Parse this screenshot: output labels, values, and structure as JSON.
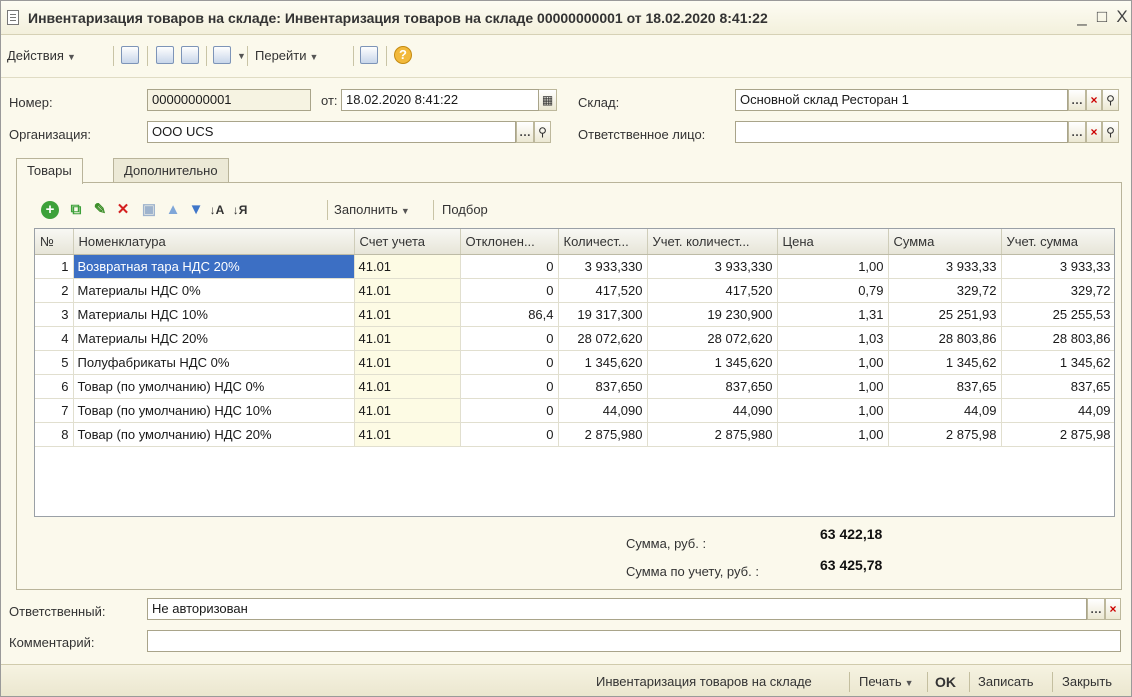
{
  "window": {
    "title": "Инвентаризация товаров на складе: Инвентаризация товаров на складе 00000000001 от 18.02.2020 8:41:22",
    "minimize": "_",
    "maximize": "□",
    "close": "X"
  },
  "toolbar": {
    "actions_label": "Действия",
    "goto_label": "Перейти",
    "help_glyph": "?"
  },
  "header": {
    "number_label": "Номер:",
    "number_value": "00000000001",
    "date_label": "от:",
    "date_value": "18.02.2020  8:41:22",
    "org_label": "Организация:",
    "org_value": "ООО UCS",
    "warehouse_label": "Склад:",
    "warehouse_value": "Основной склад Ресторан 1",
    "responsible_person_label": "Ответственное лицо:",
    "responsible_person_value": ""
  },
  "tabs": [
    {
      "label": "Товары"
    },
    {
      "label": "Дополнительно"
    }
  ],
  "table_toolbar": {
    "fill_label": "Заполнить",
    "pick_label": "Подбор"
  },
  "table": {
    "columns": [
      "№",
      "Номенклатура",
      "Счет учета",
      "Отклонен...",
      "Количест...",
      "Учет. количест...",
      "Цена",
      "Сумма",
      "Учет. сумма"
    ],
    "rows": [
      [
        "1",
        "Возвратная тара НДС 20%",
        "41.01",
        "0",
        "3 933,330",
        "3 933,330",
        "1,00",
        "3 933,33",
        "3 933,33"
      ],
      [
        "2",
        "Материалы НДС 0%",
        "41.01",
        "0",
        "417,520",
        "417,520",
        "0,79",
        "329,72",
        "329,72"
      ],
      [
        "3",
        "Материалы НДС 10%",
        "41.01",
        "86,4",
        "19 317,300",
        "19 230,900",
        "1,31",
        "25 251,93",
        "25 255,53"
      ],
      [
        "4",
        "Материалы НДС 20%",
        "41.01",
        "0",
        "28 072,620",
        "28 072,620",
        "1,03",
        "28 803,86",
        "28 803,86"
      ],
      [
        "5",
        "Полуфабрикаты НДС 0%",
        "41.01",
        "0",
        "1 345,620",
        "1 345,620",
        "1,00",
        "1 345,62",
        "1 345,62"
      ],
      [
        "6",
        "Товар (по умолчанию) НДС 0%",
        "41.01",
        "0",
        "837,650",
        "837,650",
        "1,00",
        "837,65",
        "837,65"
      ],
      [
        "7",
        "Товар (по умолчанию) НДС 10%",
        "41.01",
        "0",
        "44,090",
        "44,090",
        "1,00",
        "44,09",
        "44,09"
      ],
      [
        "8",
        "Товар (по умолчанию) НДС 20%",
        "41.01",
        "0",
        "2 875,980",
        "2 875,980",
        "1,00",
        "2 875,98",
        "2 875,98"
      ]
    ]
  },
  "totals": {
    "sum_label": "Сумма, руб. :",
    "sum_value": "63 422,18",
    "acc_sum_label": "Сумма по учету, руб. :",
    "acc_sum_value": "63 425,78"
  },
  "footer": {
    "responsible_label": "Ответственный:",
    "responsible_value": "Не авторизован",
    "comment_label": "Комментарий:",
    "comment_value": ""
  },
  "statusbar": {
    "doc_label": "Инвентаризация товаров на складе",
    "print_label": "Печать",
    "ok_label": "OK",
    "save_label": "Записать",
    "close_label": "Закрыть"
  },
  "colors": {
    "window_bg": "#fbf9ec",
    "selection": "#3c6fc4",
    "clear_x": "#cc0000"
  }
}
